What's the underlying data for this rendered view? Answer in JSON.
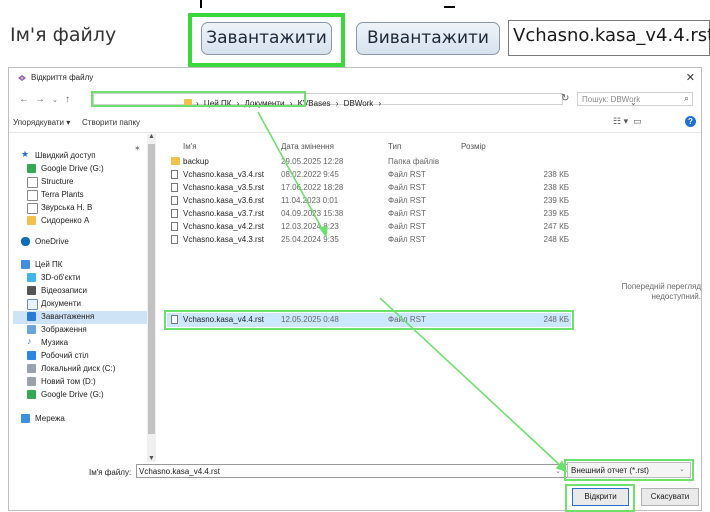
{
  "app": {
    "file_label": "Ім'я файлу",
    "load_button": "Завантажити",
    "unload_button": "Вивантажити",
    "file_value": "Vchasno.kasa_v4.4.rst"
  },
  "dialog": {
    "title": "Відкриття файлу",
    "close": "✕",
    "breadcrumbs": [
      "Цей ПК",
      "Документи",
      "KVBases",
      "DBWork"
    ],
    "search_placeholder": "Пошук: DBWork",
    "organize": "Упорядкувати ▾",
    "new_folder": "Створити папку",
    "nav": {
      "quick_access": "Швидкий доступ",
      "google_drive_g": "Google Drive (G:)",
      "structure": "Structure",
      "terra_plants": "Terra Plants",
      "zvurska": "Звурська Н. В",
      "sydorenko": "Сидоренко А",
      "onedrive": "OneDrive",
      "this_pc": "Цей ПК",
      "objects3d": "3D-об'єкти",
      "videos": "Відеозаписи",
      "documents": "Документи",
      "downloads": "Завантаження",
      "pictures": "Зображення",
      "music": "Музика",
      "desktop": "Робочий стіл",
      "local_c": "Локальний диск (C:)",
      "new_volume_d": "Новий том (D:)",
      "google_drive_g2": "Google Drive (G:)",
      "network": "Мережа"
    },
    "columns": {
      "name": "Ім'я",
      "date": "Дата змінення",
      "type": "Тип",
      "size": "Розмір"
    },
    "files": [
      {
        "name": "backup",
        "date": "29.05.2025 12:28",
        "type": "Папка файлів",
        "size": ""
      },
      {
        "name": "Vchasno.kasa_v3.4.rst",
        "date": "08.02.2022 9:45",
        "type": "Файл RST",
        "size": "238 КБ"
      },
      {
        "name": "Vchasno.kasa_v3.5.rst",
        "date": "17.06.2022 18:28",
        "type": "Файл RST",
        "size": "238 КБ"
      },
      {
        "name": "Vchasno.kasa_v3.6.rst",
        "date": "11.04.2023 0:01",
        "type": "Файл RST",
        "size": "239 КБ"
      },
      {
        "name": "Vchasno.kasa_v3.7.rst",
        "date": "04.09.2023 15:38",
        "type": "Файл RST",
        "size": "239 КБ"
      },
      {
        "name": "Vchasno.kasa_v4.2.rst",
        "date": "12.03.2024 8:23",
        "type": "Файл RST",
        "size": "247 КБ"
      },
      {
        "name": "Vchasno.kasa_v4.3.rst",
        "date": "25.04.2024 9:35",
        "type": "Файл RST",
        "size": "248 КБ"
      },
      {
        "name": "Vchasno.kasa_v4.4.rst",
        "date": "12.05.2025 0:48",
        "type": "Файл RST",
        "size": "248 КБ"
      }
    ],
    "preview_text": "Попередній перегляд недоступний.",
    "filename_label": "Ім'я файлу:",
    "filename_value": "Vchasno.kasa_v4.4.rst",
    "filter_value": "Внешний отчет (*.rst)",
    "open_button": "Відкрити",
    "cancel_button": "Скасувати"
  },
  "colors": {
    "highlight_green": "#3ad83a",
    "selection_blue": "#cce8ff",
    "folder_yellow": "#f2c14d"
  }
}
